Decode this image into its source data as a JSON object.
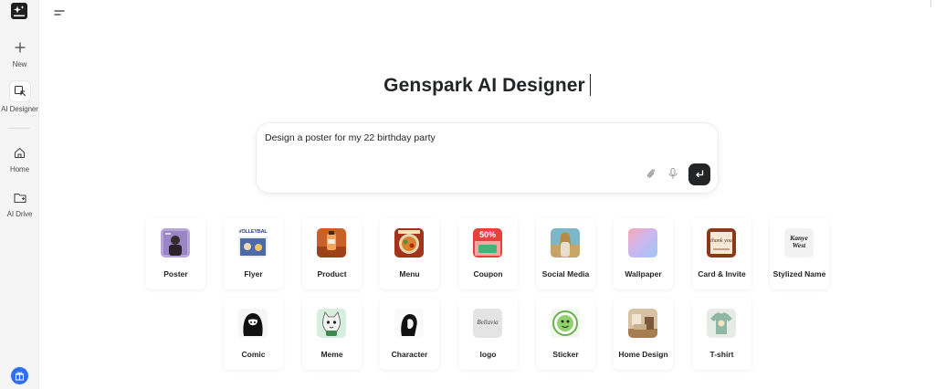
{
  "sidebar": {
    "items": [
      {
        "label": "New",
        "icon": "plus-icon"
      },
      {
        "label": "AI Designer",
        "icon": "designer-icon"
      },
      {
        "label": "Home",
        "icon": "home-icon"
      },
      {
        "label": "AI Drive",
        "icon": "folder-icon"
      }
    ]
  },
  "main": {
    "title": "Genspark AI Designer",
    "prompt": {
      "value": "Design a poster for my 22 birthday party"
    },
    "categories": [
      {
        "label": "Poster"
      },
      {
        "label": "Flyer",
        "thumb_text": "VOLLEYBALL"
      },
      {
        "label": "Product"
      },
      {
        "label": "Menu"
      },
      {
        "label": "Coupon",
        "thumb_text": "50%"
      },
      {
        "label": "Social Media"
      },
      {
        "label": "Wallpaper"
      },
      {
        "label": "Card & Invite",
        "thumb_text": "thank you"
      },
      {
        "label": "Stylized Name",
        "thumb_text": "Kanye West"
      },
      {
        "label": "Comic"
      },
      {
        "label": "Meme"
      },
      {
        "label": "Character"
      },
      {
        "label": "logo",
        "thumb_text": "Bellavia"
      },
      {
        "label": "Sticker"
      },
      {
        "label": "Home Design"
      },
      {
        "label": "T-shirt"
      }
    ]
  },
  "colors": {
    "accent": "#2f6fec",
    "dark": "#232425",
    "sidebar_bg": "#f5f5f5"
  }
}
